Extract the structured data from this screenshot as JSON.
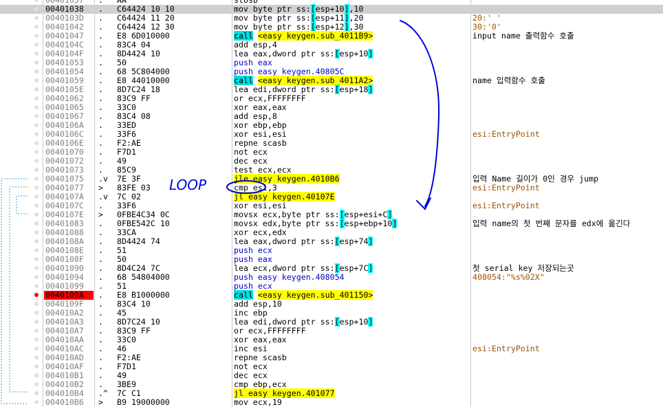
{
  "listing": [
    {
      "addr": "00401037",
      "mark": ".",
      "bytes": "AA",
      "dis": "stosb",
      "cmt": "",
      "type": "plain",
      "partial": true
    },
    {
      "addr": "00401038",
      "mark": ".",
      "bytes": "C64424 10 10",
      "dis": "mov byte ptr ss:[esp+10],10",
      "cmt": "",
      "type": "mem",
      "highlight": true
    },
    {
      "addr": "0040103D",
      "mark": ".",
      "bytes": "C64424 11 20",
      "dis": "mov byte ptr ss:[esp+11],20",
      "cmt": "20:' '",
      "type": "mem",
      "cmtStyle": "str"
    },
    {
      "addr": "00401042",
      "mark": ".",
      "bytes": "C64424 12 30",
      "dis": "mov byte ptr ss:[esp+12],30",
      "cmt": "30:'0'",
      "type": "mem",
      "cmtStyle": "str"
    },
    {
      "addr": "00401047",
      "mark": ".",
      "bytes": "E8 6D010000",
      "dis": "call <easy keygen.sub_4011B9>",
      "cmt": "input name 출력함수 호출",
      "type": "call"
    },
    {
      "addr": "0040104C",
      "mark": ".",
      "bytes": "83C4 04",
      "dis": "add esp,4",
      "cmt": "",
      "type": "plain"
    },
    {
      "addr": "0040104F",
      "mark": ".",
      "bytes": "8D4424 10",
      "dis": "lea eax,dword ptr ss:[esp+10]",
      "cmt": "",
      "type": "mem"
    },
    {
      "addr": "00401053",
      "mark": ".",
      "bytes": "50",
      "dis": "push eax",
      "cmt": "",
      "type": "push"
    },
    {
      "addr": "00401054",
      "mark": ".",
      "bytes": "68 5C804000",
      "dis": "push easy keygen.40805C",
      "cmt": "",
      "type": "push"
    },
    {
      "addr": "00401059",
      "mark": ".",
      "bytes": "E8 44010000",
      "dis": "call <easy keygen.sub_4011A2>",
      "cmt": "name 입력함수 호출",
      "type": "call"
    },
    {
      "addr": "0040105E",
      "mark": ".",
      "bytes": "8D7C24 18",
      "dis": "lea edi,dword ptr ss:[esp+18]",
      "cmt": "",
      "type": "mem"
    },
    {
      "addr": "00401062",
      "mark": ".",
      "bytes": "83C9 FF",
      "dis": "or ecx,FFFFFFFF",
      "cmt": "",
      "type": "plain"
    },
    {
      "addr": "00401065",
      "mark": ".",
      "bytes": "33C0",
      "dis": "xor eax,eax",
      "cmt": "",
      "type": "plain"
    },
    {
      "addr": "00401067",
      "mark": ".",
      "bytes": "83C4 08",
      "dis": "add esp,8",
      "cmt": "",
      "type": "plain"
    },
    {
      "addr": "0040106A",
      "mark": ".",
      "bytes": "33ED",
      "dis": "xor ebp,ebp",
      "cmt": "",
      "type": "plain"
    },
    {
      "addr": "0040106C",
      "mark": ".",
      "bytes": "33F6",
      "dis": "xor esi,esi",
      "cmt": "esi:EntryPoint",
      "type": "plain",
      "cmtStyle": "ep"
    },
    {
      "addr": "0040106E",
      "mark": ".",
      "bytes": "F2:AE",
      "dis": "repne scasb",
      "cmt": "",
      "type": "plain"
    },
    {
      "addr": "00401070",
      "mark": ".",
      "bytes": "F7D1",
      "dis": "not ecx",
      "cmt": "",
      "type": "plain"
    },
    {
      "addr": "00401072",
      "mark": ".",
      "bytes": "49",
      "dis": "dec ecx",
      "cmt": "",
      "type": "plain"
    },
    {
      "addr": "00401073",
      "mark": ".",
      "bytes": "85C9",
      "dis": "test ecx,ecx",
      "cmt": "",
      "type": "plain"
    },
    {
      "addr": "00401075",
      "mark": ".v",
      "bytes": "7E 3F",
      "dis": "jle easy keygen.4010B6",
      "cmt": "입력 Name 길이가 0인 경우 jump",
      "type": "jmp"
    },
    {
      "addr": "00401077",
      "mark": ">",
      "bytes": "83FE 03",
      "dis": "cmp esi,3",
      "cmt": "esi:EntryPoint",
      "type": "plain",
      "cmtStyle": "ep"
    },
    {
      "addr": "0040107A",
      "mark": ".v",
      "bytes": "7C 02",
      "dis": "jl easy keygen.40107E",
      "cmt": "",
      "type": "jmp"
    },
    {
      "addr": "0040107C",
      "mark": ".",
      "bytes": "33F6",
      "dis": "xor esi,esi",
      "cmt": "esi:EntryPoint",
      "type": "plain",
      "cmtStyle": "ep"
    },
    {
      "addr": "0040107E",
      "mark": ">",
      "bytes": "0FBE4C34 0C",
      "dis": "movsx ecx,byte ptr ss:[esp+esi+C]",
      "cmt": "",
      "type": "mem"
    },
    {
      "addr": "00401083",
      "mark": ".",
      "bytes": "0FBE542C 10",
      "dis": "movsx edx,byte ptr ss:[esp+ebp+10]",
      "cmt": "입력 name의 첫 번째 문자를 edx에 옮긴다",
      "type": "mem"
    },
    {
      "addr": "00401088",
      "mark": ".",
      "bytes": "33CA",
      "dis": "xor ecx,edx",
      "cmt": "",
      "type": "plain"
    },
    {
      "addr": "0040108A",
      "mark": ".",
      "bytes": "8D4424 74",
      "dis": "lea eax,dword ptr ss:[esp+74]",
      "cmt": "",
      "type": "mem"
    },
    {
      "addr": "0040108E",
      "mark": ".",
      "bytes": "51",
      "dis": "push ecx",
      "cmt": "",
      "type": "push"
    },
    {
      "addr": "0040108F",
      "mark": ".",
      "bytes": "50",
      "dis": "push eax",
      "cmt": "",
      "type": "push"
    },
    {
      "addr": "00401090",
      "mark": ".",
      "bytes": "8D4C24 7C",
      "dis": "lea ecx,dword ptr ss:[esp+7C]",
      "cmt": "첫 serial key 저장되는곳",
      "type": "mem"
    },
    {
      "addr": "00401094",
      "mark": ".",
      "bytes": "68 54804000",
      "dis": "push easy keygen.408054",
      "cmt": "408054:\"%s%02X\"",
      "type": "push",
      "cmtStyle": "str"
    },
    {
      "addr": "00401099",
      "mark": ".",
      "bytes": "51",
      "dis": "push ecx",
      "cmt": "",
      "type": "push"
    },
    {
      "addr": "0040109A",
      "mark": ".",
      "bytes": "E8 B1000000",
      "dis": "call <easy keygen.sub_401150>",
      "cmt": "",
      "type": "call",
      "breakpoint": true
    },
    {
      "addr": "0040109F",
      "mark": ".",
      "bytes": "83C4 10",
      "dis": "add esp,10",
      "cmt": "",
      "type": "plain"
    },
    {
      "addr": "004010A2",
      "mark": ".",
      "bytes": "45",
      "dis": "inc ebp",
      "cmt": "",
      "type": "plain"
    },
    {
      "addr": "004010A3",
      "mark": ".",
      "bytes": "8D7C24 10",
      "dis": "lea edi,dword ptr ss:[esp+10]",
      "cmt": "",
      "type": "mem"
    },
    {
      "addr": "004010A7",
      "mark": ".",
      "bytes": "83C9 FF",
      "dis": "or ecx,FFFFFFFF",
      "cmt": "",
      "type": "plain"
    },
    {
      "addr": "004010AA",
      "mark": ".",
      "bytes": "33C0",
      "dis": "xor eax,eax",
      "cmt": "",
      "type": "plain"
    },
    {
      "addr": "004010AC",
      "mark": ".",
      "bytes": "46",
      "dis": "inc esi",
      "cmt": "esi:EntryPoint",
      "type": "plain",
      "cmtStyle": "ep"
    },
    {
      "addr": "004010AD",
      "mark": ".",
      "bytes": "F2:AE",
      "dis": "repne scasb",
      "cmt": "",
      "type": "plain"
    },
    {
      "addr": "004010AF",
      "mark": ".",
      "bytes": "F7D1",
      "dis": "not ecx",
      "cmt": "",
      "type": "plain"
    },
    {
      "addr": "004010B1",
      "mark": ".",
      "bytes": "49",
      "dis": "dec ecx",
      "cmt": "",
      "type": "plain"
    },
    {
      "addr": "004010B2",
      "mark": ".",
      "bytes": "3BE9",
      "dis": "cmp ebp,ecx",
      "cmt": "",
      "type": "plain"
    },
    {
      "addr": "004010B4",
      "mark": ".^",
      "bytes": "7C C1",
      "dis": "jl easy keygen.401077",
      "cmt": "",
      "type": "jmp"
    },
    {
      "addr": "004010B6",
      "mark": ">",
      "bytes": "B9 19000000",
      "dis": "mov ecx,19",
      "cmt": "",
      "type": "plain"
    }
  ],
  "annotation": {
    "loop_label": "LOOP"
  },
  "colors": {
    "call": "#00e0e0",
    "jump": "#ffff00",
    "breakpoint": "#ff0000",
    "selected_row": "#d0d0d0",
    "comment_ref": "#a05000",
    "ink": "#0000dd"
  }
}
